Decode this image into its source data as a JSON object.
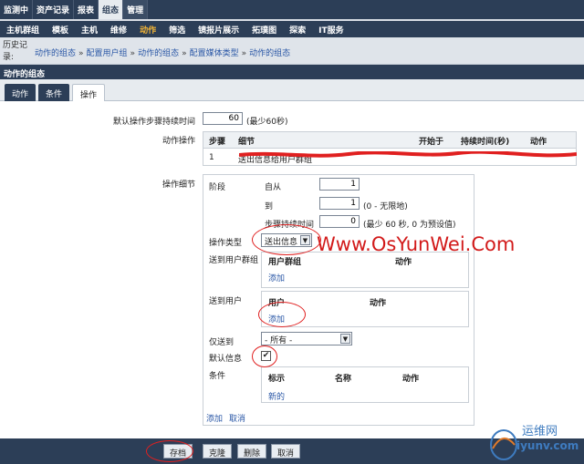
{
  "top_nav": [
    "监测中",
    "资产记录",
    "报表",
    "组态",
    "管理"
  ],
  "sub_nav": [
    "主机群组",
    "模板",
    "主机",
    "维修",
    "动作",
    "筛选",
    "镜报片展示",
    "拓璞图",
    "探索",
    "IT服务"
  ],
  "crumb_label": "历史记录:",
  "breadcrumbs": [
    "动作的组态",
    "配置用户组",
    "动作的组态",
    "配置媒体类型",
    "动作的组态"
  ],
  "section_title": "动作的组态",
  "tabs": [
    "动作",
    "条件",
    "操作"
  ],
  "form": {
    "default_step_duration_label": "默认操作步骤持续时间",
    "default_step_duration_value": "60",
    "default_step_duration_hint": "(最少60秒)",
    "operations_label": "动作操作",
    "ops_headers": {
      "step": "步骤",
      "detail": "细节",
      "start": "开始于",
      "duration": "持续时间(秒)",
      "action": "动作"
    },
    "ops_row": {
      "step": "1",
      "detail": "送出信息给用户群组"
    },
    "details_label": "操作细节",
    "stage_label": "阶段",
    "from_label": "自从",
    "from_value": "1",
    "to_label": "到",
    "to_value": "1",
    "to_hint": "(0 - 无限地)",
    "step_duration_label": "步骤持续时间",
    "step_duration_value": "0",
    "step_duration_hint": "(最少 60 秒, 0 为预设值)",
    "op_type_label": "操作类型",
    "op_type_value": "送出信息",
    "send_to_groups_label": "送到用户群组",
    "groups_header_user_group": "用户群组",
    "groups_header_action": "动作",
    "groups_add": "添加",
    "send_to_users_label": "送到用户",
    "users_header_user": "用户",
    "users_header_action": "动作",
    "users_add": "添加",
    "send_only_to_label": "仅送到",
    "send_only_to_value": "- 所有 -",
    "default_message_label": "默认信息",
    "default_message_checked": "✔",
    "conditions_label": "条件",
    "cond_header_tag": "标示",
    "cond_header_name": "名称",
    "cond_header_action": "动作",
    "cond_new": "新的",
    "add_link": "添加",
    "cancel_link": "取消"
  },
  "watermark": "Www.OsYunWei.Com",
  "logo_text_1": "运维网",
  "logo_text_2": "iyunv.com",
  "buttons": {
    "save": "存档",
    "clone": "克隆",
    "delete": "删除",
    "cancel": "取消"
  },
  "colors": {
    "nav_bg": "#2c3e57",
    "active_sub_nav": "#f2b436",
    "link": "#2a57a6",
    "annotation": "#e02020"
  }
}
